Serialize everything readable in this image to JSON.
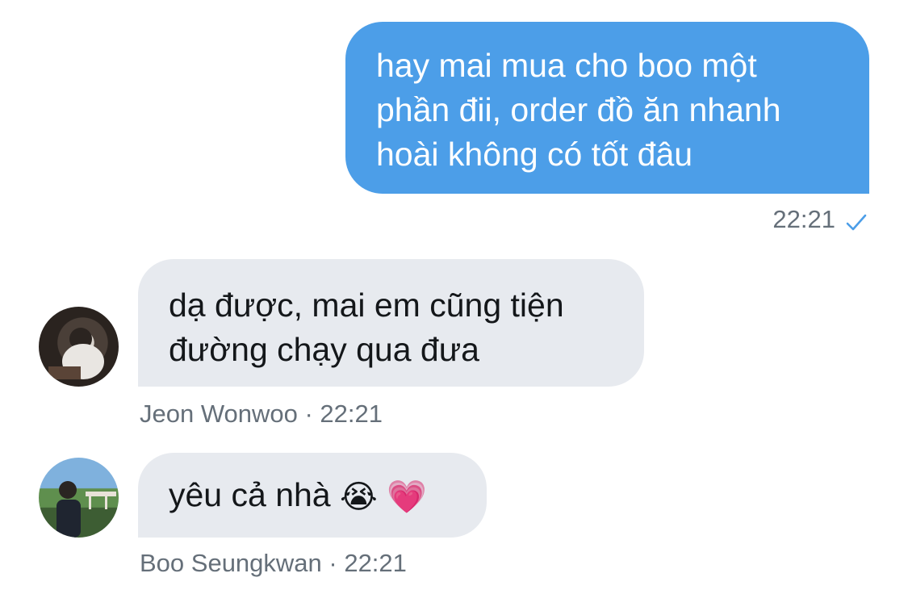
{
  "messages": [
    {
      "direction": "outgoing",
      "lines": [
        "hay mai mua cho boo một",
        "phần đii, order đồ ăn nhanh",
        "hoài không có tốt đâu"
      ],
      "time": "22:21",
      "status_icon": "check-icon"
    },
    {
      "direction": "incoming",
      "lines": [
        "dạ được, mai em cũng tiện",
        "đường chạy qua đưa"
      ],
      "sender": "Jeon Wonwoo",
      "time": "22:21",
      "meta": "Jeon Wonwoo · 22:21"
    },
    {
      "direction": "incoming",
      "text": "yêu cả nhà",
      "emojis": [
        "😭",
        "💗"
      ],
      "sender": "Boo Seungkwan",
      "time": "22:21",
      "meta": "Boo Seungkwan · 22:21"
    }
  ],
  "colors": {
    "outgoing_bubble": "#4c9ee8",
    "incoming_bubble": "#e7eaef",
    "meta_text": "#656f79",
    "check": "#4c9ee8"
  }
}
